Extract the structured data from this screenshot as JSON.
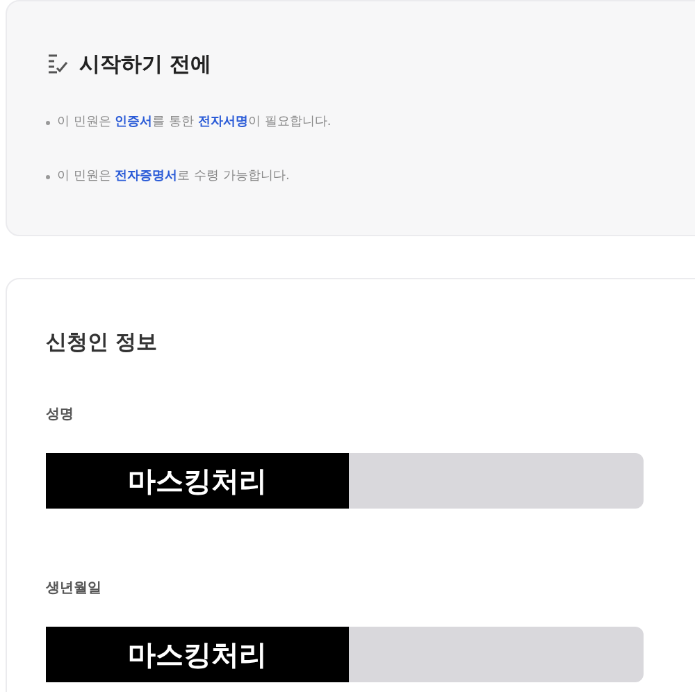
{
  "notice": {
    "title": "시작하기 전에",
    "items": [
      "이 민원은 **인증서**를 통한 **전자서명**이 필요합니다.",
      "이 민원은 **전자증명서**로 수령 가능합니다."
    ]
  },
  "applicant": {
    "title": "신청인 정보",
    "fields": [
      {
        "label": "성명",
        "mask": "마스킹처리"
      },
      {
        "label": "생년월일",
        "mask": "마스킹처리"
      }
    ]
  }
}
